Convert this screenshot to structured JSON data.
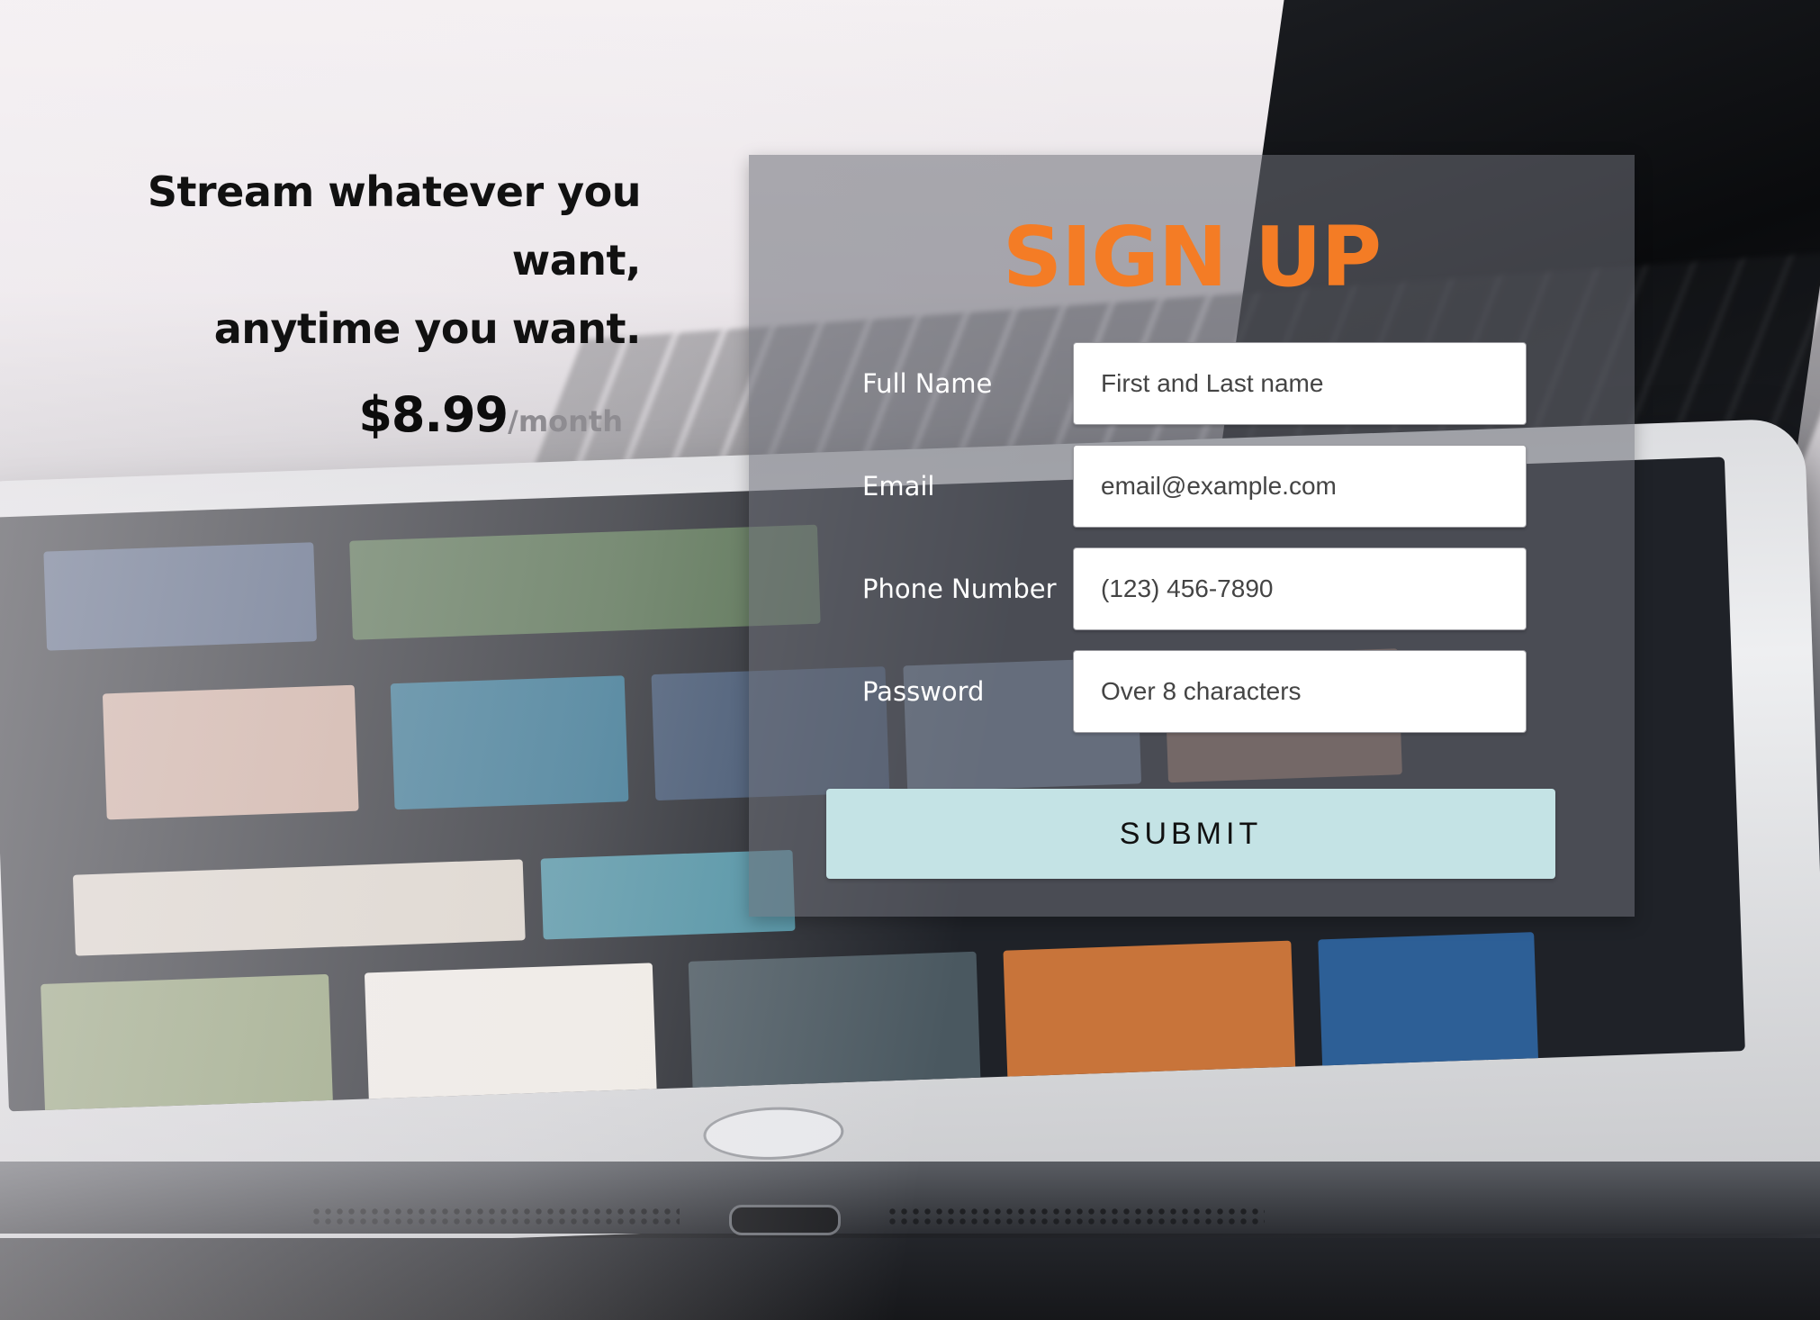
{
  "hero": {
    "line1": "Stream whatever you want,",
    "line2": "anytime you want.",
    "price": "$8.99",
    "per_period": "/month"
  },
  "form": {
    "title": "SIGN UP",
    "fields": [
      {
        "label": "Full Name",
        "placeholder": "First and Last name",
        "value": ""
      },
      {
        "label": "Email",
        "placeholder": "email@example.com",
        "value": ""
      },
      {
        "label": "Phone Number",
        "placeholder": "(123) 456-7890",
        "value": ""
      },
      {
        "label": "Password",
        "placeholder": "Over 8 characters",
        "value": ""
      }
    ],
    "submit_label": "SUBMIT"
  },
  "colors": {
    "accent": "#f47c25",
    "submit_bg": "#c4e3e5",
    "panel_overlay": "rgba(110,112,120,0.55)",
    "hero_text": "#111111",
    "period_text": "#8e8c91"
  }
}
